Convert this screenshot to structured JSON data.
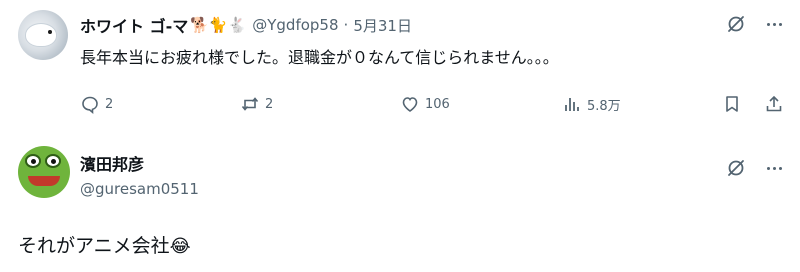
{
  "tweet1": {
    "display_name": "ホワイト ゴ-マ",
    "name_emojis": "🐕🐈🐇",
    "handle": "@Ygdfop58",
    "separator": "·",
    "date": "5月31日",
    "text": "長年本当にお疲れ様でした。退職金が０なんて信じられません。。。",
    "actions": {
      "reply_count": "2",
      "repost_count": "2",
      "like_count": "106",
      "view_count": "5.8万"
    }
  },
  "tweet2": {
    "display_name": "濱田邦彦",
    "handle": "@guresam0511",
    "text": "それがアニメ会社",
    "text_emoji": "😂"
  },
  "icons": {
    "grok": "grok-icon",
    "more": "more-icon",
    "reply": "reply-icon",
    "repost": "repost-icon",
    "like": "heart-icon",
    "views": "views-icon",
    "bookmark": "bookmark-icon",
    "share": "share-icon"
  },
  "colors": {
    "text": "#0f1419",
    "secondary": "#536471",
    "background": "#ffffff"
  }
}
